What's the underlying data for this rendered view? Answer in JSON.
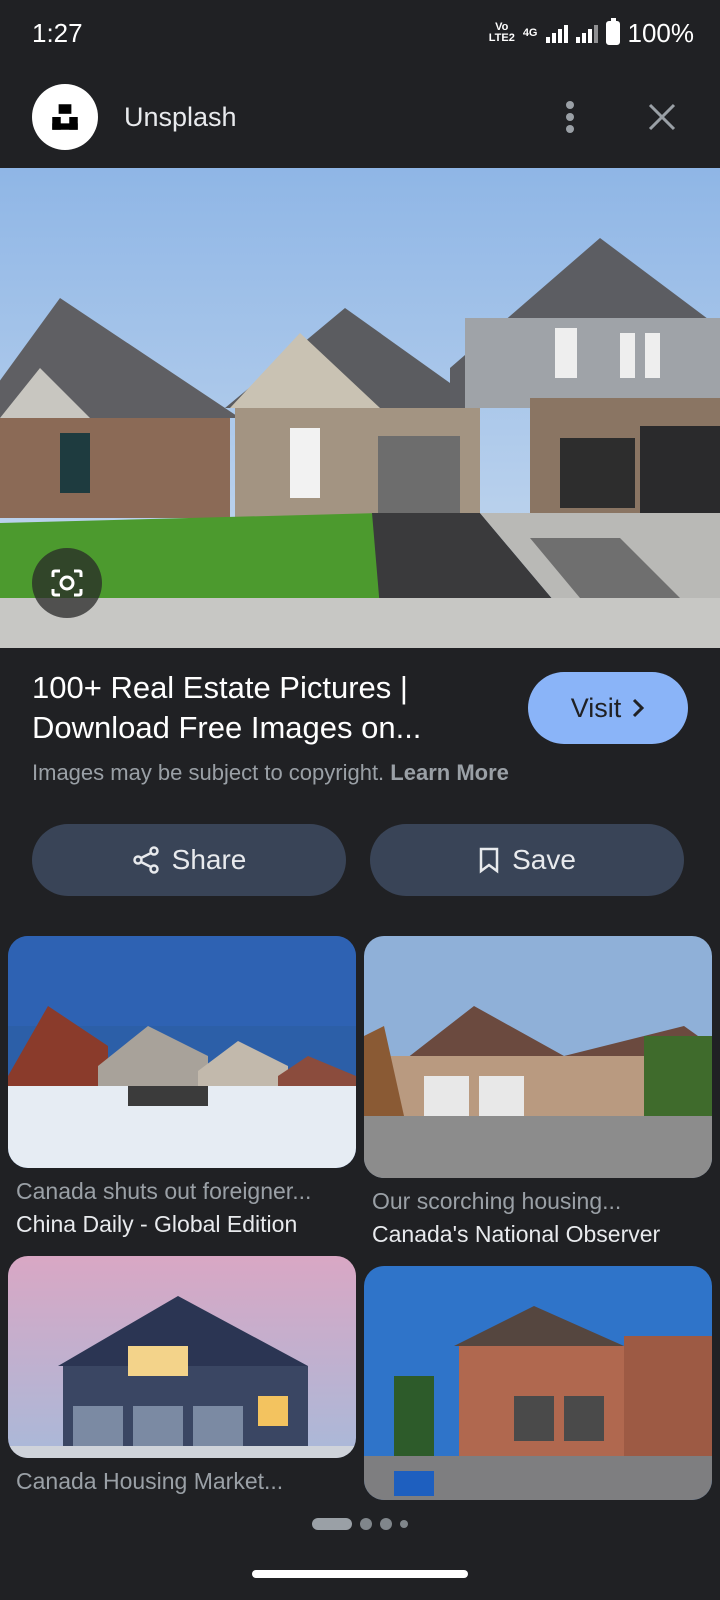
{
  "status_bar": {
    "time": "1:27",
    "network_tag_top": "Vo LTE2",
    "network_type": "4G",
    "battery": "100%"
  },
  "header": {
    "site_name": "Unsplash",
    "logo_icon": "unsplash-logo",
    "more_icon": "more-vert-icon",
    "close_icon": "close-icon"
  },
  "result": {
    "title": "100+ Real Estate Pictures | Download Free Images on...",
    "visit_label": "Visit",
    "copyright_text": "Images may be subject to copyright.",
    "learn_more": "Learn More"
  },
  "actions": {
    "share_label": "Share",
    "save_label": "Save"
  },
  "related": [
    {
      "caption": "Canada shuts out foreigner...",
      "source": "China Daily - Global Edition"
    },
    {
      "caption": "Our scorching housing...",
      "source": "Canada's National Observer"
    },
    {
      "caption": "Canada Housing Market...",
      "source": ""
    },
    {
      "caption": "",
      "source": ""
    }
  ],
  "colors": {
    "background": "#202124",
    "accent": "#8ab4f8",
    "button_bg": "#394457"
  }
}
